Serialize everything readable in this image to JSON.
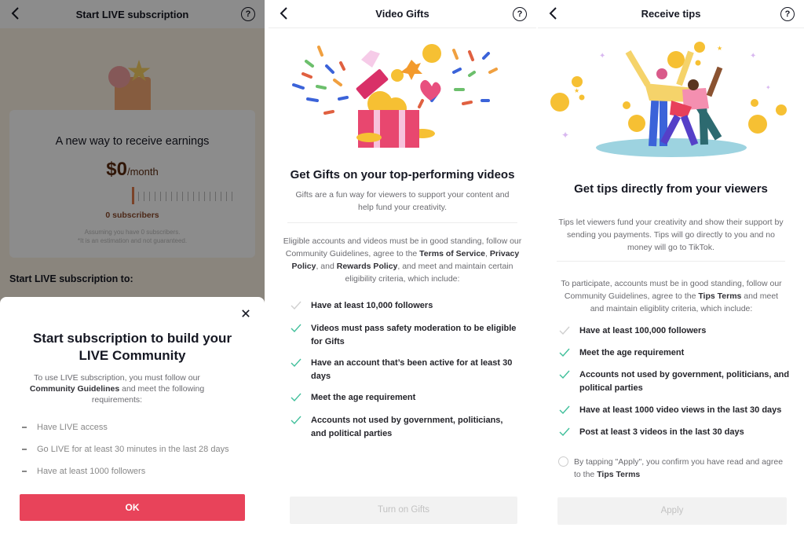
{
  "live_subscription": {
    "header": {
      "title": "Start LIVE subscription",
      "back_icon": "chevron-left-icon",
      "help_icon": "question-circle-icon"
    },
    "earnings_card": {
      "title": "A new way to receive earnings",
      "amount": "$0",
      "period": "/month",
      "slider_value": 0,
      "subscribers": "0 subscribers",
      "note_line1": "Assuming you have 0 subscribers.",
      "note_line2": "*It is an estimation and not guaranteed."
    },
    "section_heading": "Start LIVE subscription to:",
    "modal": {
      "close_icon": "close-icon",
      "title": "Start subscription to build your LIVE Community",
      "intro_before": "To use LIVE subscription, you must follow our ",
      "intro_link": "Community Guidelines",
      "intro_after": " and meet the following requirements:",
      "requirements": [
        "Have LIVE access",
        "Go LIVE for at least 30 minutes in the last 28 days",
        "Have at least 1000 followers"
      ],
      "ok_label": "OK",
      "ok_color": "#e8435a"
    }
  },
  "video_gifts": {
    "header": {
      "title": "Video Gifts",
      "back_icon": "chevron-left-icon",
      "help_icon": "question-circle-icon"
    },
    "heading": "Get Gifts on your top-performing videos",
    "subtext": "Gifts are a fun way for viewers to support your content and help fund your creativity.",
    "eligibility": {
      "t1": "Eligible accounts and videos must be in good standing, follow our Community Guidelines, agree to the ",
      "l1": "Terms of Service",
      "t2": ", ",
      "l2": "Privacy Policy",
      "t3": ", and ",
      "l3": "Rewards Policy",
      "t4": ", and meet and maintain certain eligibility criteria, which include:"
    },
    "requirements": [
      {
        "text": "Have at least 10,000 followers",
        "met": false
      },
      {
        "text": "Videos must pass safety moderation to be eligible for Gifts",
        "met": true
      },
      {
        "text": "Have an account that’s been active for at least 30 days",
        "met": true
      },
      {
        "text": "Meet the age requirement",
        "met": true
      },
      {
        "text": "Accounts not used by government, politicians, and political parties",
        "met": true
      }
    ],
    "button_label": "Turn on Gifts"
  },
  "receive_tips": {
    "header": {
      "title": "Receive tips",
      "back_icon": "chevron-left-icon",
      "help_icon": "question-circle-icon"
    },
    "heading": "Get tips directly from your viewers",
    "subtext": "Tips let viewers fund your creativity and show their support by sending you payments. Tips will go directly to you and no money will go to TikTok.",
    "eligibility": {
      "t1": "To participate, accounts must be in good standing, follow our Community Guidelines, agree to the ",
      "l1": "Tips Terms",
      "t2": " and meet and maintain eligiblity criteria, which include:"
    },
    "requirements": [
      {
        "text": "Have at least 100,000 followers",
        "met": false
      },
      {
        "text": "Meet the age requirement",
        "met": true
      },
      {
        "text": "Accounts not used by government, politicians, and political parties",
        "met": true
      },
      {
        "text": "Have at least 1000 video views in the last 30 days",
        "met": true
      },
      {
        "text": "Post at least 3 videos in the last 30 days",
        "met": true
      }
    ],
    "consent_before": "By tapping \"Apply\", you confirm you have read and agree to the ",
    "consent_link": "Tips Terms",
    "consent_checked": false,
    "button_label": "Apply"
  },
  "colors": {
    "check_met": "#3fbf9a",
    "check_unmet": "#cfcfcf",
    "accent": "#e8435a"
  }
}
